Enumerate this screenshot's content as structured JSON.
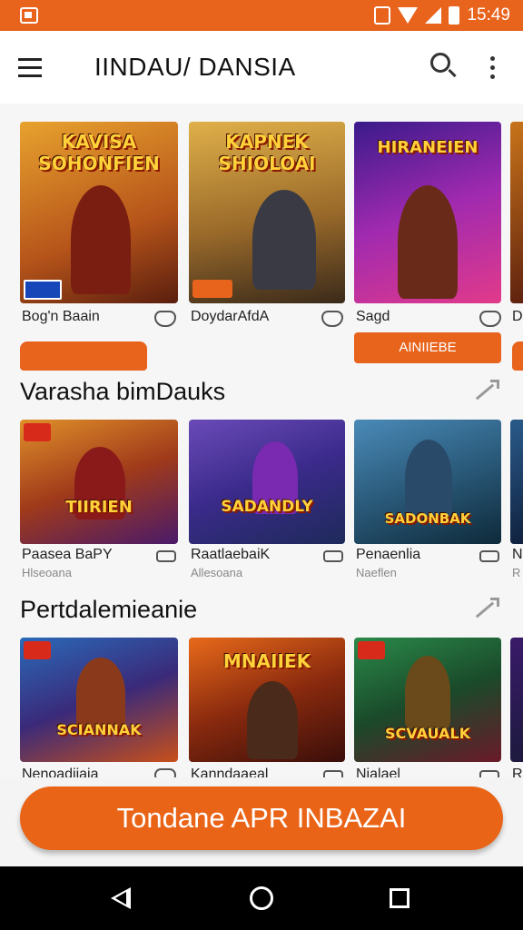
{
  "status_bar": {
    "time": "15:49"
  },
  "app_bar": {
    "title": "IINDAU/ DANSIA"
  },
  "featured": {
    "cards": [
      {
        "label": "Bog'n Baain",
        "art_title": "KAVISA SOHONFIEN",
        "colors": [
          "#d98a1e",
          "#7a2b0e"
        ]
      },
      {
        "label": "DoydarAfdA",
        "art_title": "KAPNEK SHIOLOAI",
        "colors": [
          "#c9932e",
          "#5a4a2a"
        ]
      },
      {
        "label": "Sagd",
        "art_title": "HIRANEIEN",
        "colors": [
          "#6a1ea8",
          "#e23aa0"
        ]
      },
      {
        "label": "D",
        "art_title": "",
        "colors": [
          "#b8641a",
          "#5a1e0e"
        ]
      }
    ],
    "action_label": "AINIIEBE"
  },
  "sections": [
    {
      "title": "Varasha bimDauks",
      "cards": [
        {
          "label": "Paasea BaPY",
          "sub": "Hlseoana",
          "art_title": "TIIRIEN",
          "colors": [
            "#c75a18",
            "#4a1a6a"
          ]
        },
        {
          "label": "RaatlaebaiK",
          "sub": "Allesoana",
          "art_title": "SADANDLY",
          "colors": [
            "#5a3aa0",
            "#1e3a7a"
          ]
        },
        {
          "label": "Penaenlia",
          "sub": "Naeflen",
          "art_title": "SADONBAK",
          "colors": [
            "#2a6a9a",
            "#0e2a4a"
          ]
        },
        {
          "label": "N",
          "sub": "R",
          "art_title": "",
          "colors": [
            "#2a5a8a",
            "#0e1e3a"
          ]
        }
      ]
    },
    {
      "title": "Pertdalemieanie",
      "cards": [
        {
          "label": "Nenoadiiaia",
          "sub": "",
          "art_title": "SCIANNAK",
          "colors": [
            "#1e5aa8",
            "#c8501a"
          ]
        },
        {
          "label": "Kanndaaeal",
          "sub": "",
          "art_title": "MNAIIEK",
          "colors": [
            "#8a2a0e",
            "#e86a1a"
          ]
        },
        {
          "label": "Nialael",
          "sub": "",
          "art_title": "SCVAUALK",
          "colors": [
            "#1a6a3a",
            "#6a1a2a"
          ]
        },
        {
          "label": "Ri",
          "sub": "",
          "art_title": "",
          "colors": [
            "#3a1a6a",
            "#1a1a3a"
          ]
        }
      ]
    }
  ],
  "cta": {
    "label": "Tondane APR INBAZAI"
  },
  "colors": {
    "accent": "#e8631c",
    "navbar": "#000000"
  },
  "icons": [
    "menu-icon",
    "search-icon",
    "more-vert-icon",
    "trending-icon",
    "heart-icon",
    "back-icon",
    "home-icon",
    "recents-icon"
  ]
}
